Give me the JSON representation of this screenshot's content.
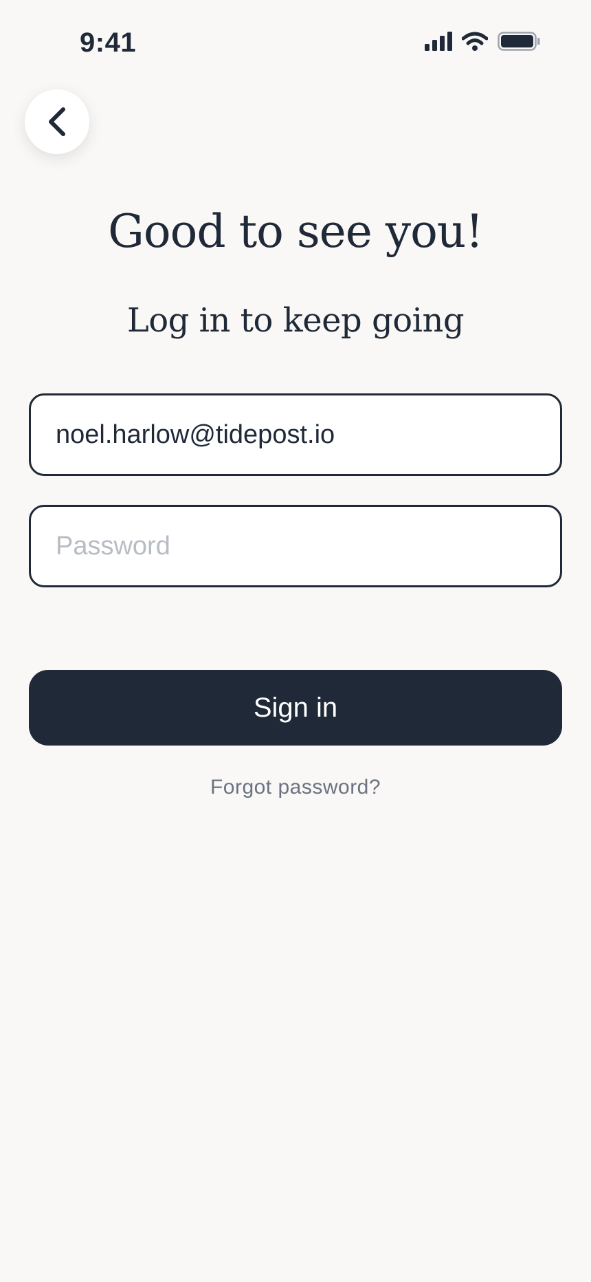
{
  "status_bar": {
    "time": "9:41",
    "icons": [
      "cellular-signal-icon",
      "wifi-icon",
      "battery-icon"
    ]
  },
  "nav": {
    "back_icon": "chevron-left-icon"
  },
  "header": {
    "title": "Good to see you!",
    "subtitle": "Log in to keep going"
  },
  "form": {
    "email_value": "noel.harlow@tidepost.io",
    "password_value": "",
    "password_placeholder": "Password",
    "submit_label": "Sign in",
    "forgot_label": "Forgot password?"
  },
  "colors": {
    "background": "#f9f8f6",
    "primary": "#1f2937",
    "muted": "#6b7280",
    "placeholder": "#b8bcc3"
  }
}
